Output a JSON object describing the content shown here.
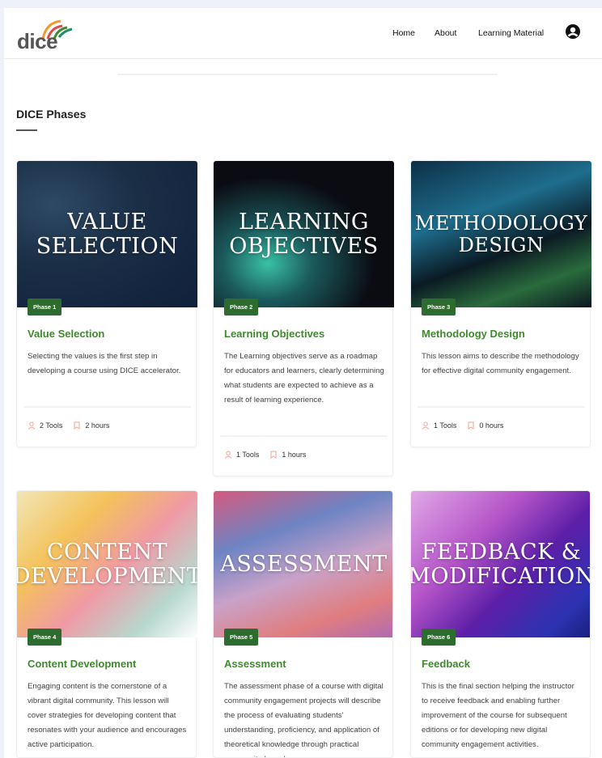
{
  "header": {
    "logo_text": "dice",
    "nav": {
      "home": "Home",
      "about": "About",
      "learning_material": "Learning Material"
    }
  },
  "section": {
    "title": "DICE Phases"
  },
  "cards": [
    {
      "image_text": "VALUE SELECTION",
      "badge": "Phase 1",
      "title": "Value Selection",
      "description": "Selecting the values is the first step in developing a course using DICE accelerator.",
      "tools": "2 Tools",
      "hours": "2 hours"
    },
    {
      "image_text": "LEARNING OBJECTIVES",
      "badge": "Phase 2",
      "title": "Learning Objectives",
      "description": "The Learning objectives serve as a roadmap for educators and learners, clearly determining what students are expected to achieve as a result of learning experience.",
      "tools": "1 Tools",
      "hours": "1 hours"
    },
    {
      "image_text": "METHODOLOGY DESIGN",
      "badge": "Phase 3",
      "title": "Methodology Design",
      "description": "This lesson aims to describe the methodology for effective digital community engagement.",
      "tools": "1 Tools",
      "hours": "0 hours"
    },
    {
      "image_text": "CONTENT DEVELOPMENT",
      "badge": "Phase 4",
      "title": "Content Development",
      "description": "Engaging content is the cornerstone of a vibrant digital community. This lesson will cover strategies for developing content that resonates with your audience and encourages active participation."
    },
    {
      "image_text": "ASSESSMENT",
      "badge": "Phase 5",
      "title": "Assessment",
      "description": "The assessment phase of a course with digital community engagement projects will describe the process of evaluating students' understanding, proficiency, and application of theoretical knowledge through practical community-based"
    },
    {
      "image_text": "FEEDBACK & MODIFICATION",
      "badge": "Phase 6",
      "title": "Feedback",
      "description": "This is the final section helping the instructor to receive feedback and enabling further improvement of the course for subsequent editions or for developing new digital community engagement activities."
    }
  ],
  "colors": {
    "accent": "#3e8a2c",
    "badge_bg": "#2e6b2e"
  },
  "icons": {
    "user": "user-circle-icon",
    "tools": "user-outline-icon",
    "hours": "bookmark-icon"
  }
}
